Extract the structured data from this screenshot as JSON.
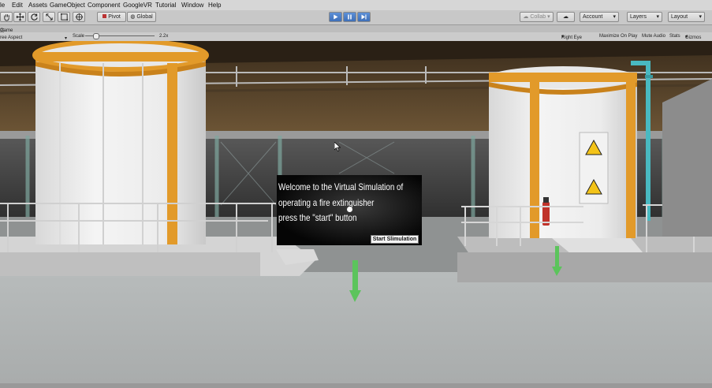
{
  "menu": [
    "le",
    "Edit",
    "Assets",
    "GameObject",
    "Component",
    "GoogleVR",
    "Tutorial",
    "Window",
    "Help"
  ],
  "toolbar": {
    "pivot": "Pivot",
    "global": "Global",
    "collab": "Collab",
    "account": "Account",
    "layers": "Layers",
    "layout": "Layout"
  },
  "tabs": {
    "game": "Game"
  },
  "gamebar": {
    "aspect": "ree Aspect",
    "scale_label": "Scale",
    "scale_value": "2.2x",
    "eye": "Right Eye",
    "maximize": "Maximize On Play",
    "mute": "Mute Audio",
    "stats": "Stats",
    "gizmos": "Gizmos"
  },
  "scene": {
    "welcome_lines": [
      "Welcome to the Virtual Simulation of",
      "operating a fire extinguisher",
      "press the \"start\" button"
    ],
    "start_button": "Start Slimulation"
  },
  "colors": {
    "tank_orange": "#e29a2a",
    "arrow_green": "#5cc45c",
    "pipe_teal": "#49b9c1",
    "play_blue": "#4a7fcb"
  }
}
